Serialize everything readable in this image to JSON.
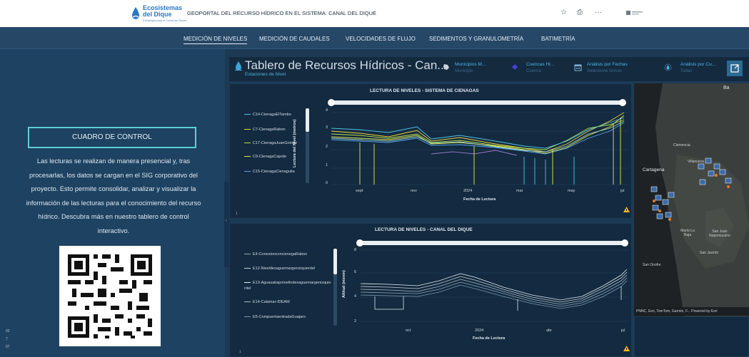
{
  "header": {
    "logo_line1": "Ecosistemas",
    "logo_line2": "del Dique",
    "logo_tagline": "Estrategia para el Canal del Dique",
    "title": "GEOPORTAL DEL RECURSO HÍDRICO EN EL SISTEMA: CANAL DEL DIQUE",
    "actions": {
      "star": "☆",
      "share": "⎙",
      "more": "···"
    }
  },
  "nav": {
    "items": [
      {
        "label": "MEDICIÓN DE NIVELES",
        "active": true
      },
      {
        "label": "MEDICIÓN DE CAUDALES"
      },
      {
        "label": "VELOCIDADES DE FLUJO"
      },
      {
        "label": "SEDIMENTOS Y GRANULOMETRÍA"
      },
      {
        "label": "BATIMETRÍA"
      }
    ]
  },
  "left": {
    "button_label": "CUADRO DE CONTROL",
    "description": "Las lecturas se realizan de manera presencial y, tras procesarlas, los datos se cargan en el SIG corporativo del proyecto. Esto permite consolidar, analizar y visualizar la información de las lecturas para el conocimiento del recurso hídrico. Descubra más en nuestro tablero de control interactivo.",
    "side_numbers": [
      "02",
      "7",
      "07"
    ],
    "splitter_glyph": "‹"
  },
  "dashboard": {
    "title": "Tablero de Recursos Hídricos - Can...",
    "subtitle": "Estaciones de Nivel",
    "filters": [
      {
        "title": "Municipios M...",
        "sub": "Municipio"
      },
      {
        "title": "Cuencas Hi...",
        "sub": "Cuenca"
      },
      {
        "title": "Análisis por Fechas",
        "sub": "Seleccione fechas"
      },
      {
        "title": "Análisis por Cu...",
        "sub": "Todas"
      }
    ],
    "panel_index": "1"
  },
  "chart_top": {
    "title": "LECTURA DE NIVELES - SISTEMA DE CIENAGAS",
    "legend": [
      {
        "name": "C14-CienagaElTambo",
        "color": "#4fc3e8"
      },
      {
        "name": "C7-CienagaRabon",
        "color": "#f2d33b"
      },
      {
        "name": "C17-CienagaJuanGomez",
        "color": "#b6e34a"
      },
      {
        "name": "C9-CienagaCapote",
        "color": "#e6e84a"
      },
      {
        "name": "C15-CienagaCienaguita",
        "color": "#5aa6e8"
      }
    ],
    "y_label": "Lectura del Nivel (metros)",
    "y_ticks": [
      "4",
      "3",
      "2",
      "1",
      "0"
    ],
    "x_ticks": [
      "sept",
      "nov",
      "2024",
      "mar",
      "may",
      "jul"
    ],
    "x_label": "Fecha de Lectura"
  },
  "chart_bottom": {
    "title": "LECTURA DE NIVELES - CANAL DEL DIQUE",
    "legend": [
      {
        "name": "E4-ConexionconcienegaRabon",
        "color": "#8fa6b8"
      },
      {
        "name": "E12-Niveldesaguemargenizquierdel",
        "color": "#c8d2da"
      },
      {
        "name": "E13-Aguasabajorioelindesaguemargenizquierdel",
        "color": "#e8eef2"
      },
      {
        "name": "E14-Calamar-IDEAM",
        "color": "#a9bac7"
      },
      {
        "name": "E5-CompuertaentradaGuajaro",
        "color": "#7c97ab"
      }
    ],
    "y_label": "Altitud (msnm)",
    "y_ticks": [
      "8",
      "6",
      "4",
      "2"
    ],
    "x_ticks": [
      "oct",
      "2024",
      "abr",
      "jul"
    ],
    "x_label": "Fecha de Lectura"
  },
  "map": {
    "labels": [
      "Clemencia",
      "Villanueva",
      "Cartagena",
      "María La Baja",
      "San Juan Nepomuceno",
      "San Jacinto",
      "San Onofre",
      "Ba"
    ],
    "attribution": "PNNC, Esri, TomTom, Garmin, F...   Powered by Esri"
  }
}
